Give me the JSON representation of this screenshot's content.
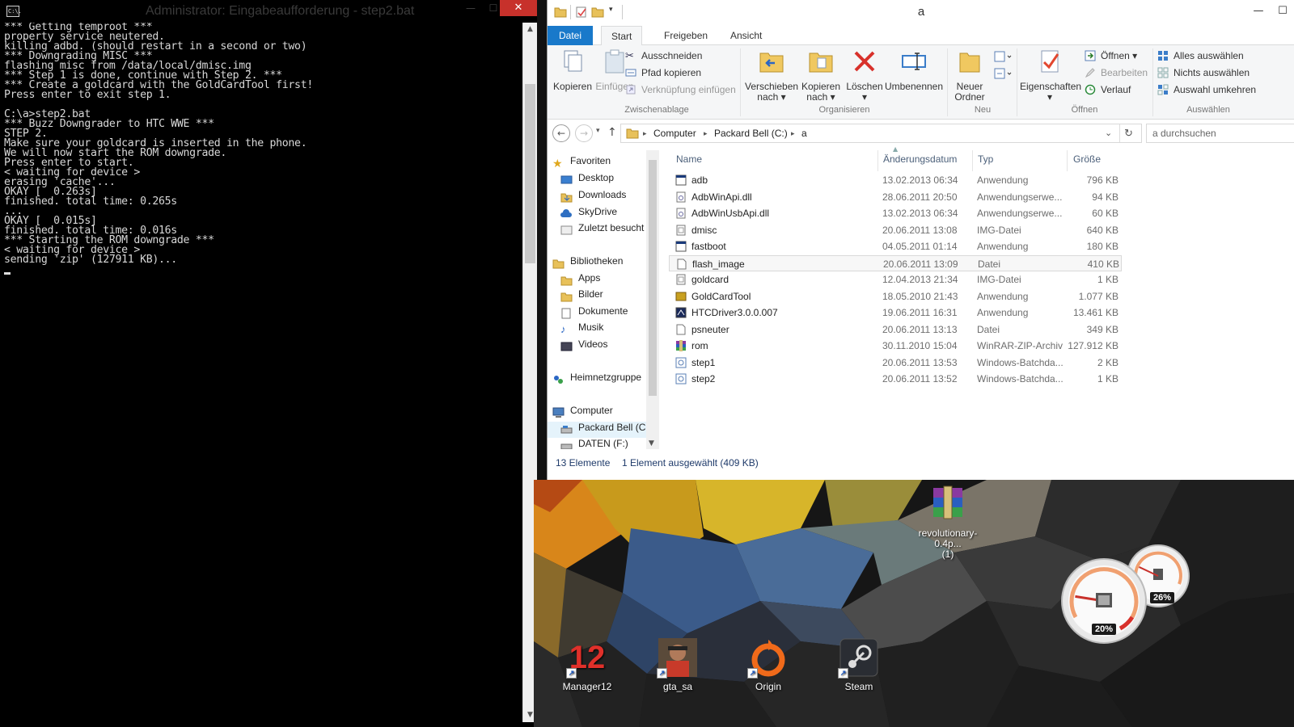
{
  "cmd": {
    "title": "Administrator: Eingabeaufforderung - step2.bat",
    "icon_text": "C:\\.",
    "min_glyph": "—",
    "max_glyph": "☐",
    "close_glyph": "✕",
    "lines": [
      "*** Getting temproot ***",
      "property service neutered.",
      "killing adbd. (should restart in a second or two)",
      "*** Downgrading MISC ***",
      "flashing misc from /data/local/dmisc.img",
      "*** Step 1 is done, continue with Step 2. ***",
      "*** Create a goldcard with the GoldCardTool first!",
      "Press enter to exit step 1.",
      "",
      "C:\\a>step2.bat",
      "*** Buzz Downgrader to HTC WWE ***",
      "STEP 2.",
      "Make sure your goldcard is inserted in the phone.",
      "We will now start the ROM downgrade.",
      "Press enter to start.",
      "< waiting for device >",
      "erasing 'cache'...",
      "OKAY [  0.263s]",
      "finished. total time: 0.265s",
      "...",
      "OKAY [  0.015s]",
      "finished. total time: 0.016s",
      "*** Starting the ROM downgrade ***",
      "< waiting for device >",
      "sending 'zip' (127911 KB)..."
    ]
  },
  "explorer": {
    "title": "a",
    "tabs": [
      "Datei",
      "Start",
      "Freigeben",
      "Ansicht"
    ],
    "ribbon": {
      "clipboard": {
        "label": "Zwischenablage",
        "copy": "Kopieren",
        "paste": "Einfügen",
        "cut": "Ausschneiden",
        "copy_path": "Pfad kopieren",
        "paste_shortcut": "Verknüpfung einfügen"
      },
      "organize": {
        "label": "Organisieren",
        "move_to": "Verschieben",
        "move_to_2": "nach ▾",
        "copy_to": "Kopieren",
        "copy_to_2": "nach ▾",
        "delete": "Löschen",
        "delete_2": "▾",
        "rename": "Umbenennen"
      },
      "new": {
        "label": "Neu",
        "new_folder": "Neuer",
        "new_folder_2": "Ordner"
      },
      "open": {
        "label": "Öffnen",
        "properties": "Eigenschaften",
        "properties_2": "▾",
        "open": "Öffnen ▾",
        "edit": "Bearbeiten",
        "history": "Verlauf"
      },
      "select": {
        "label": "Auswählen",
        "select_all": "Alles auswählen",
        "select_none": "Nichts auswählen",
        "invert": "Auswahl umkehren"
      }
    },
    "address": {
      "crumbs": [
        "Computer",
        "Packard Bell (C:)",
        "a"
      ],
      "search_placeholder": "a durchsuchen"
    },
    "nav": {
      "favorites": "Favoriten",
      "desktop": "Desktop",
      "downloads": "Downloads",
      "skydrive": "SkyDrive",
      "recent": "Zuletzt besucht",
      "libraries": "Bibliotheken",
      "apps": "Apps",
      "pictures": "Bilder",
      "documents": "Dokumente",
      "music": "Musik",
      "videos": "Videos",
      "homegroup": "Heimnetzgruppe",
      "computer": "Computer",
      "drive_c": "Packard Bell (C:)",
      "drive_f": "DATEN (F:)"
    },
    "columns": [
      "Name",
      "Änderungsdatum",
      "Typ",
      "Größe"
    ],
    "files": [
      {
        "name": "adb",
        "date": "13.02.2013 06:34",
        "type": "Anwendung",
        "size": "796 KB",
        "icon": "app-icon"
      },
      {
        "name": "AdbWinApi.dll",
        "date": "28.06.2011 20:50",
        "type": "Anwendungserwe...",
        "size": "94 KB",
        "icon": "dll-icon"
      },
      {
        "name": "AdbWinUsbApi.dll",
        "date": "13.02.2013 06:34",
        "type": "Anwendungserwe...",
        "size": "60 KB",
        "icon": "dll-icon"
      },
      {
        "name": "dmisc",
        "date": "20.06.2011 13:08",
        "type": "IMG-Datei",
        "size": "640 KB",
        "icon": "img-file-icon"
      },
      {
        "name": "fastboot",
        "date": "04.05.2011 01:14",
        "type": "Anwendung",
        "size": "180 KB",
        "icon": "app-icon"
      },
      {
        "name": "flash_image",
        "date": "20.06.2011 13:09",
        "type": "Datei",
        "size": "410 KB",
        "icon": "file-icon"
      },
      {
        "name": "goldcard",
        "date": "12.04.2013 21:34",
        "type": "IMG-Datei",
        "size": "1 KB",
        "icon": "img-file-icon"
      },
      {
        "name": "GoldCardTool",
        "date": "18.05.2010 21:43",
        "type": "Anwendung",
        "size": "1.077 KB",
        "icon": "goldcard-tool-icon"
      },
      {
        "name": "HTCDriver3.0.0.007",
        "date": "19.06.2011 16:31",
        "type": "Anwendung",
        "size": "13.461 KB",
        "icon": "installer-icon"
      },
      {
        "name": "psneuter",
        "date": "20.06.2011 13:13",
        "type": "Datei",
        "size": "349 KB",
        "icon": "file-icon"
      },
      {
        "name": "rom",
        "date": "30.11.2010 15:04",
        "type": "WinRAR-ZIP-Archiv",
        "size": "127.912 KB",
        "icon": "winrar-icon"
      },
      {
        "name": "step1",
        "date": "20.06.2011 13:53",
        "type": "Windows-Batchda...",
        "size": "2 KB",
        "icon": "batch-file-icon"
      },
      {
        "name": "step2",
        "date": "20.06.2011 13:52",
        "type": "Windows-Batchda...",
        "size": "1 KB",
        "icon": "batch-file-icon"
      }
    ],
    "selected_file": "flash_image",
    "status": {
      "count": "13 Elemente",
      "selection": "1 Element ausgewählt (409 KB)"
    }
  },
  "desktop": {
    "file_icon": {
      "label": "revolutionary-0.4p...",
      "label_2": "(1)"
    },
    "shortcuts": [
      {
        "label": "Manager12",
        "badge": "12"
      },
      {
        "label": "gta_sa"
      },
      {
        "label": "Origin"
      },
      {
        "label": "Steam"
      }
    ],
    "gadget": {
      "cpu_percent": "20%",
      "memory_percent": "26%",
      "cpu_level": 0.2,
      "memory_level": 0.26
    }
  },
  "colors": {
    "file_tab": "#1979ca",
    "close_button": "#c7312b",
    "status_text": "#1e3a6a"
  }
}
